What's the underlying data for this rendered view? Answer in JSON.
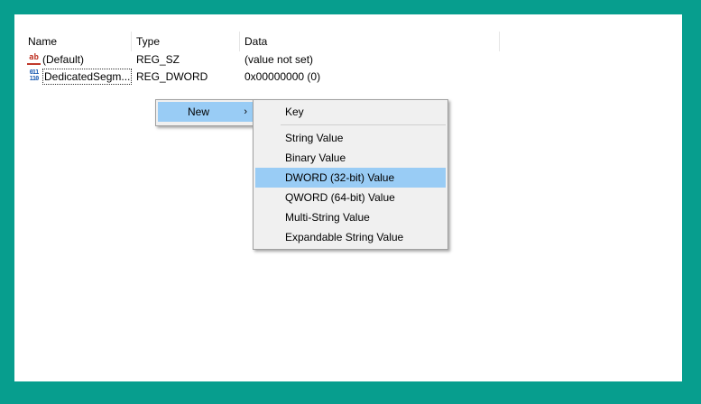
{
  "columns": {
    "name": "Name",
    "type": "Type",
    "data": "Data"
  },
  "rows": [
    {
      "name": "(Default)",
      "type": "REG_SZ",
      "data": "(value not set)",
      "icon": "string-value-icon"
    },
    {
      "name": "DedicatedSegm...",
      "type": "REG_DWORD",
      "data": "0x00000000 (0)",
      "icon": "binary-value-icon"
    }
  ],
  "context_menu": {
    "new_label": "New",
    "arrow": "›"
  },
  "submenu": {
    "items": [
      "Key",
      "String Value",
      "Binary Value",
      "DWORD (32-bit) Value",
      "QWORD (64-bit) Value",
      "Multi-String Value",
      "Expandable String Value"
    ],
    "highlighted": "DWORD (32-bit) Value"
  },
  "colors": {
    "frame": "#079e8e",
    "highlight": "#99ccf5",
    "menu_bg": "#f0f0f0"
  }
}
